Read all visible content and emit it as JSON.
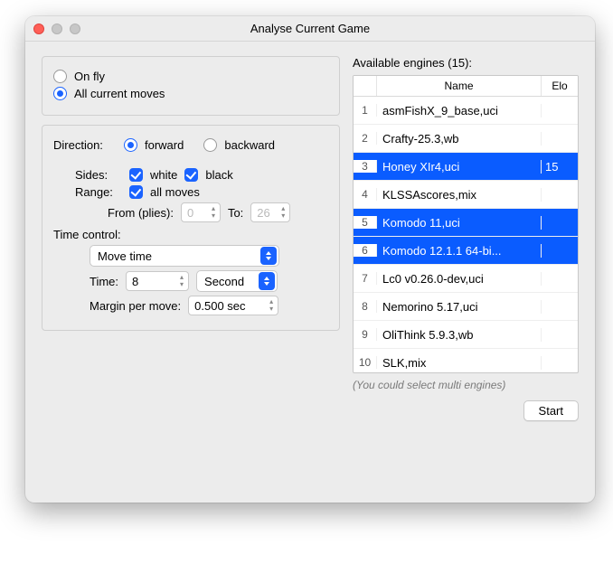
{
  "window": {
    "title": "Analyse Current Game"
  },
  "mode": {
    "on_fly": "On fly",
    "all_moves": "All current moves",
    "on_fly_checked": false,
    "all_moves_checked": true
  },
  "direction": {
    "label": "Direction:",
    "forward": "forward",
    "backward": "backward",
    "forward_checked": true,
    "backward_checked": false
  },
  "sides": {
    "label": "Sides:",
    "white": "white",
    "black": "black",
    "white_checked": true,
    "black_checked": true
  },
  "range": {
    "label": "Range:",
    "all_moves_lbl": "all moves",
    "all_moves_checked": true,
    "from_lbl": "From (plies):",
    "from_val": "0",
    "to_lbl": "To:",
    "to_val": "26"
  },
  "time_control": {
    "title": "Time control:",
    "type": "Move time",
    "time_lbl": "Time:",
    "time_val": "8",
    "unit": "Second",
    "margin_lbl": "Margin per move:",
    "margin_val": "0.500 sec"
  },
  "engines": {
    "heading": "Available engines (15):",
    "col_idx": "",
    "col_name": "Name",
    "col_elo": "Elo",
    "hint": "(You could select multi engines)",
    "rows": [
      {
        "idx": "1",
        "name": "asmFishX_9_base,uci",
        "elo": "",
        "selected": false
      },
      {
        "idx": "2",
        "name": "Crafty-25.3,wb",
        "elo": "",
        "selected": false
      },
      {
        "idx": "3",
        "name": "Honey XIr4,uci",
        "elo": "15",
        "selected": true
      },
      {
        "idx": "4",
        "name": "KLSSAscores,mix",
        "elo": "",
        "selected": false
      },
      {
        "idx": "5",
        "name": "Komodo 11,uci",
        "elo": "",
        "selected": true
      },
      {
        "idx": "6",
        "name": "Komodo 12.1.1 64-bi...",
        "elo": "",
        "selected": true
      },
      {
        "idx": "7",
        "name": "Lc0 v0.26.0-dev,uci",
        "elo": "",
        "selected": false
      },
      {
        "idx": "8",
        "name": "Nemorino 5.17,uci",
        "elo": "",
        "selected": false
      },
      {
        "idx": "9",
        "name": "OliThink 5.9.3,wb",
        "elo": "",
        "selected": false
      },
      {
        "idx": "10",
        "name": "SLK,mix",
        "elo": "",
        "selected": false
      }
    ]
  },
  "start_button": "Start"
}
